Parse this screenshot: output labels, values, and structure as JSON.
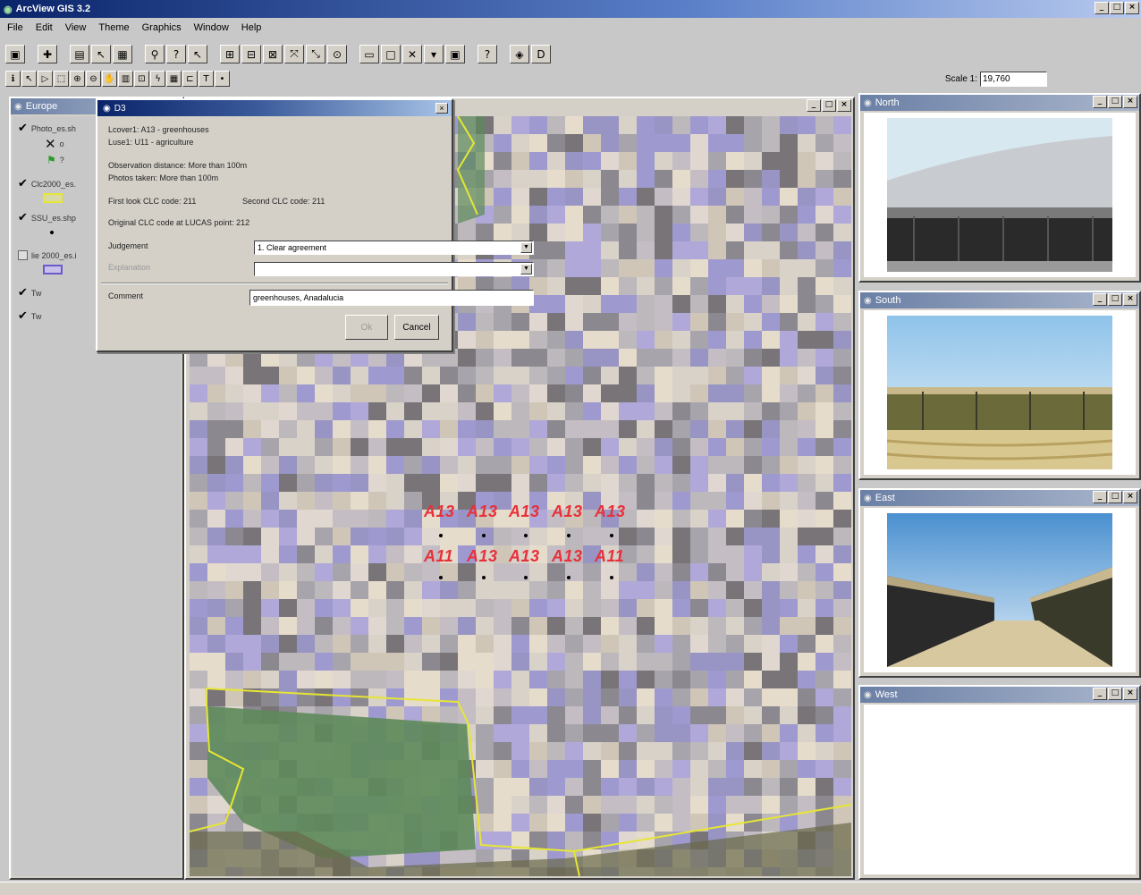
{
  "app": {
    "title": "ArcView GIS 3.2"
  },
  "menu": [
    "File",
    "Edit",
    "View",
    "Theme",
    "Graphics",
    "Window",
    "Help"
  ],
  "scale": {
    "label": "Scale 1:",
    "value": "19,760"
  },
  "toc": {
    "title": "Europe",
    "layers": [
      {
        "name": "Photo_es.sh",
        "checked": true,
        "legend": [
          "o",
          "?"
        ]
      },
      {
        "name": "Clc2000_es.",
        "checked": true
      },
      {
        "name": "SSU_es.shp",
        "checked": true
      },
      {
        "name": "lie 2000_es.i",
        "checked": false
      },
      {
        "name": "Tw",
        "checked": true
      },
      {
        "name": "Tw",
        "checked": true
      }
    ]
  },
  "dialog": {
    "title": "D3",
    "lcover": "Lcover1: A13 - greenhouses",
    "luse": "Luse1: U11 - agriculture",
    "obs_distance": "Observation distance: More than 100m",
    "photos_taken": "Photos taken: More than 100m",
    "first_look": "First look CLC code: 211",
    "second_clc": "Second CLC code: 211",
    "original_clc": "Original CLC code at LUCAS point: 212",
    "judgement_label": "Judgement",
    "judgement_value": "1. Clear agreement",
    "explanation_label": "Explanation",
    "explanation_value": "",
    "comment_label": "Comment",
    "comment_value": "greenhouses, Anadalucia",
    "ok": "Ok",
    "cancel": "Cancel"
  },
  "map": {
    "row1": [
      "A13",
      "A13",
      "A13",
      "A13",
      "A13"
    ],
    "row2": [
      "A11",
      "A13",
      "A13",
      "A13",
      "A11"
    ]
  },
  "photos": [
    {
      "title": "North"
    },
    {
      "title": "South"
    },
    {
      "title": "East"
    },
    {
      "title": "West"
    }
  ],
  "colors": {
    "label_red": "#e8303a",
    "boundary_yellow": "#e6e634",
    "forest_green": "#5d8a5a"
  }
}
